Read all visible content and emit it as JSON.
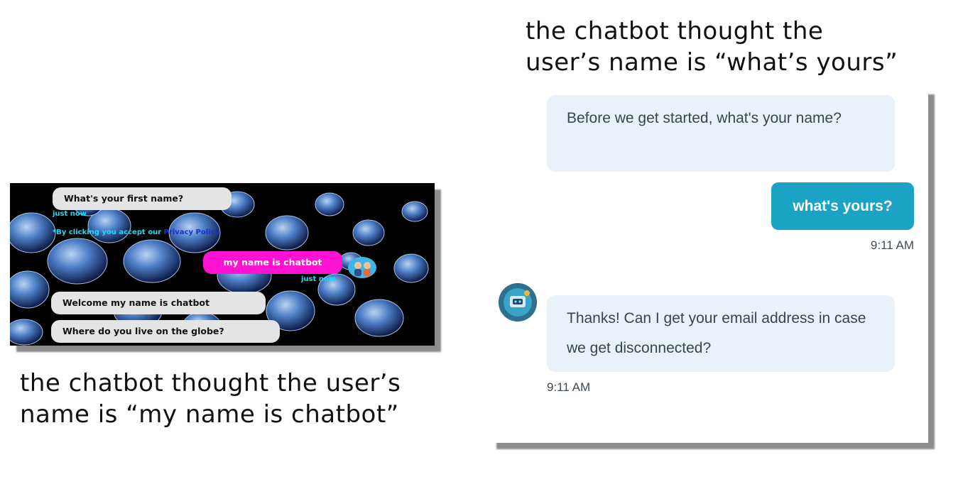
{
  "captions": {
    "right_line1": "the chatbot thought the",
    "right_line2": "user’s name is “what’s yours”",
    "left_line1": "the chatbot thought the user’s",
    "left_line2": "name is “my name is chatbot”"
  },
  "left_chat": {
    "bot_question": "What's your first name?",
    "time_1": "just now",
    "privacy_prefix": "*By clicking you accept our ",
    "privacy_link": "Privacy Policy",
    "user_reply": "my name is chatbot",
    "time_2": "just now",
    "bot_welcome": "Welcome my name is chatbot",
    "bot_next": "Where do you live on the globe?",
    "colors": {
      "user_bubble": "#ff12d2",
      "bot_bubble": "#e4e4e4",
      "timestamp": "#10e0ff"
    }
  },
  "right_chat": {
    "bot_question": "Before we get started, what's your name?",
    "user_reply": "what's yours?",
    "time_user": "9:11 AM",
    "bot_followup": "Thanks! Can I get your email address in case we get disconnected?",
    "time_bot": "9:11 AM",
    "avatar_icon": "bot-avatar-icon",
    "colors": {
      "user_bubble": "#1aa3c5",
      "bot_bubble": "#eaf1f8"
    }
  }
}
